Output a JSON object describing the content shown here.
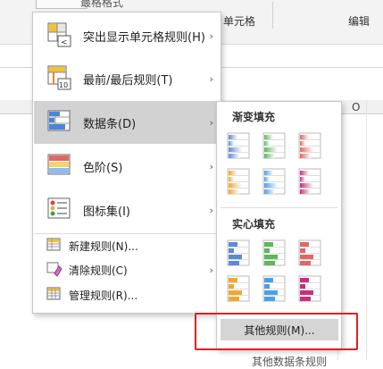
{
  "ribbon": {
    "top_cut_text": "最格格式",
    "group_cells": "单元格",
    "group_edit": "编辑"
  },
  "column_letter": "O",
  "menu": {
    "items": [
      {
        "label": "突出显示单元格规则(H)",
        "icon": "highlight-rules-icon",
        "has_submenu": true
      },
      {
        "label": "最前/最后规则(T)",
        "icon": "top-bottom-rules-icon",
        "has_submenu": true
      },
      {
        "label": "数据条(D)",
        "icon": "data-bars-icon",
        "has_submenu": true,
        "highlighted": true
      },
      {
        "label": "色阶(S)",
        "icon": "color-scales-icon",
        "has_submenu": true
      },
      {
        "label": "图标集(I)",
        "icon": "icon-sets-icon",
        "has_submenu": true
      }
    ],
    "small_items": [
      {
        "label": "新建规则(N)...",
        "icon": "new-rule-icon",
        "has_submenu": false
      },
      {
        "label": "清除规则(C)",
        "icon": "clear-rules-icon",
        "has_submenu": true
      },
      {
        "label": "管理规则(R)...",
        "icon": "manage-rules-icon",
        "has_submenu": false
      }
    ]
  },
  "submenu": {
    "gradient_heading": "渐变填充",
    "solid_heading": "实心填充",
    "more_rules": "其他规则(M)...",
    "bar_colors": [
      "#5b8bd0",
      "#5cb85c",
      "#e06666",
      "#f0a830",
      "#4aa0e8",
      "#c8307a"
    ]
  },
  "bottom_cut_text": "其他数据条规则"
}
